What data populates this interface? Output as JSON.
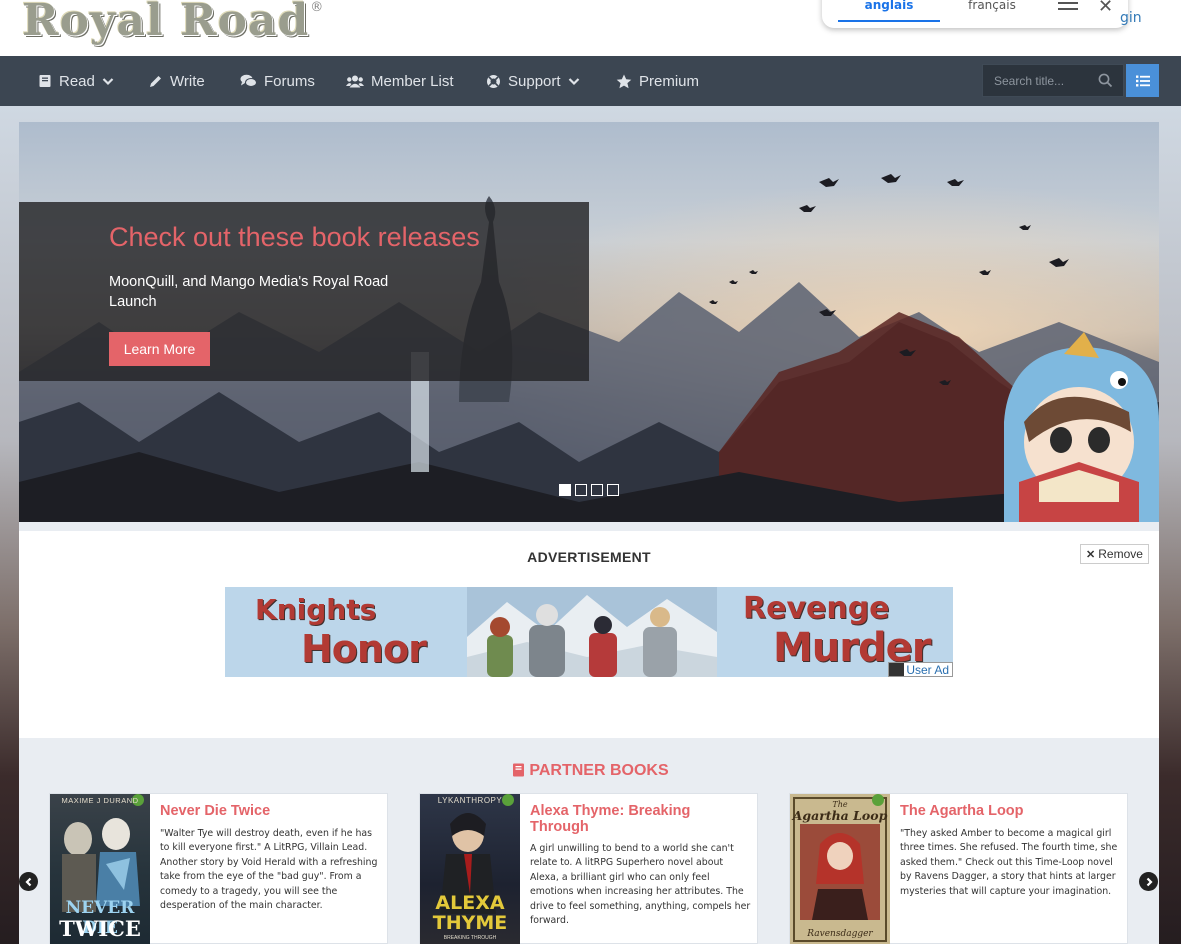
{
  "header": {
    "logo_text": "Royal Road",
    "logo_reg": "®",
    "translate": {
      "tabs": [
        "anglais",
        "français"
      ],
      "active_tab": 0
    },
    "login_label": "gin"
  },
  "nav": {
    "items": [
      {
        "label": "Read",
        "icon": "book-icon",
        "has_dropdown": true
      },
      {
        "label": "Write",
        "icon": "pencil-icon",
        "has_dropdown": false
      },
      {
        "label": "Forums",
        "icon": "comments-icon",
        "has_dropdown": false
      },
      {
        "label": "Member List",
        "icon": "users-icon",
        "has_dropdown": false
      },
      {
        "label": "Support",
        "icon": "life-ring-icon",
        "has_dropdown": true
      },
      {
        "label": "Premium",
        "icon": "star-icon",
        "has_dropdown": false
      }
    ],
    "search": {
      "placeholder": "Search title..."
    }
  },
  "hero": {
    "title": "Check out these book releases",
    "subtitle": "MoonQuill, and Mango Media's Royal Road Launch",
    "button_label": "Learn More",
    "slides": 4,
    "active_slide": 0
  },
  "advertisement": {
    "label": "ADVERTISEMENT",
    "remove_label": "Remove",
    "banner": {
      "left_text_line1": "Knights",
      "left_text_line2": "Honor",
      "right_text_line1": "Revenge",
      "right_text_line2": "Murder",
      "badge": "User Ad"
    }
  },
  "partner_books": {
    "heading": "PARTNER BOOKS",
    "books": [
      {
        "title": "Never Die Twice",
        "cover_author": "MAXIME J DURAND",
        "cover_title_line1": "NEVER DIE",
        "cover_title_line2": "TWICE",
        "description": "\"Walter Tye will destroy death, even if he has to kill everyone first.\" A LitRPG, Villain Lead. Another story by Void Herald with a refreshing take from the eye of the \"bad guy\". From a comedy to a tragedy, you will see the desperation of the main character."
      },
      {
        "title": "Alexa Thyme: Breaking Through",
        "cover_author": "LYKANTHROPY",
        "cover_title_line1": "ALEXA",
        "cover_title_line2": "THYME",
        "cover_subtitle": "BREAKING THROUGH",
        "description": "A girl unwilling to bend to a world she can't relate to. A litRPG Superhero novel about Alexa, a brilliant girl who can only feel emotions when increasing her attributes. The drive to feel something, anything, compels her forward."
      },
      {
        "title": "The Agartha Loop",
        "cover_title_line1": "The",
        "cover_title_line2": "Agartha Loop",
        "cover_author": "Ravensdagger",
        "description": "\"They asked Amber to become a magical girl three times. She refused. The fourth time, she asked them.\" Check out this Time-Loop novel by Ravens Dagger, a story that hints at larger mysteries that will capture your imagination."
      }
    ]
  },
  "colors": {
    "accent": "#e46469",
    "nav_bg": "#3c4652",
    "link": "#337ab7",
    "list_button": "#4a90d9"
  }
}
